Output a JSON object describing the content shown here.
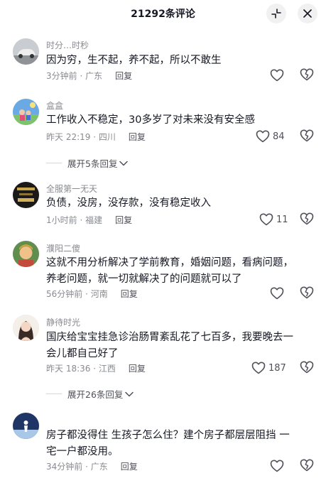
{
  "header": {
    "title": "21292条评论",
    "collapse_icon": "collapse-arrows-icon",
    "close_icon": "close-icon"
  },
  "comments": [
    {
      "username": "时分…时秒",
      "text_lines": [
        "因为穷，生不起，养不起，所以不敢生"
      ],
      "time": "3分钟前",
      "location": "广东",
      "reply": "回复",
      "likes": ""
    },
    {
      "username": "盒盒",
      "text_lines": [
        "工作收入不稳定，30多岁了对未来没有安全感"
      ],
      "time": "昨天 22:19",
      "location": "四川",
      "reply": "回复",
      "likes": "84"
    },
    {
      "username": "全服第一无天",
      "text_lines": [
        "负债，没房，没存款，没有稳定收入"
      ],
      "time": "1小时前",
      "location": "福建",
      "reply": "回复",
      "likes": "11"
    },
    {
      "username": "濮阳二傻",
      "text_lines": [
        "这就不用分析解决了学前教育，婚姻问题，看病问题，",
        "养老问题，就一切就解决了的问题就可以了"
      ],
      "time": "56分钟前",
      "location": "河南",
      "reply": "回复",
      "likes": ""
    },
    {
      "username": "静待时光",
      "text_lines": [
        "国庆给宝宝挂急诊治肠胃紊乱花了七百多，我要晚去一",
        "会儿都自己好了"
      ],
      "time": "昨天 18:36",
      "location": "江西",
      "reply": "回复",
      "likes": "187"
    },
    {
      "username": "",
      "text_lines": [
        "房子都没得住 生孩子怎么住？建个房子都层层阻挡 一",
        "宅一户都没用。"
      ],
      "time": "34分钟前",
      "location": "广东",
      "reply": "回复",
      "likes": ""
    }
  ],
  "expand_replies": [
    {
      "label": "展开5条回复"
    },
    {
      "label": "展开26条回复"
    }
  ],
  "colors": {
    "text_primary": "#161823",
    "text_secondary": "#8a8b91",
    "header_button_bg": "#f1f1f2"
  }
}
